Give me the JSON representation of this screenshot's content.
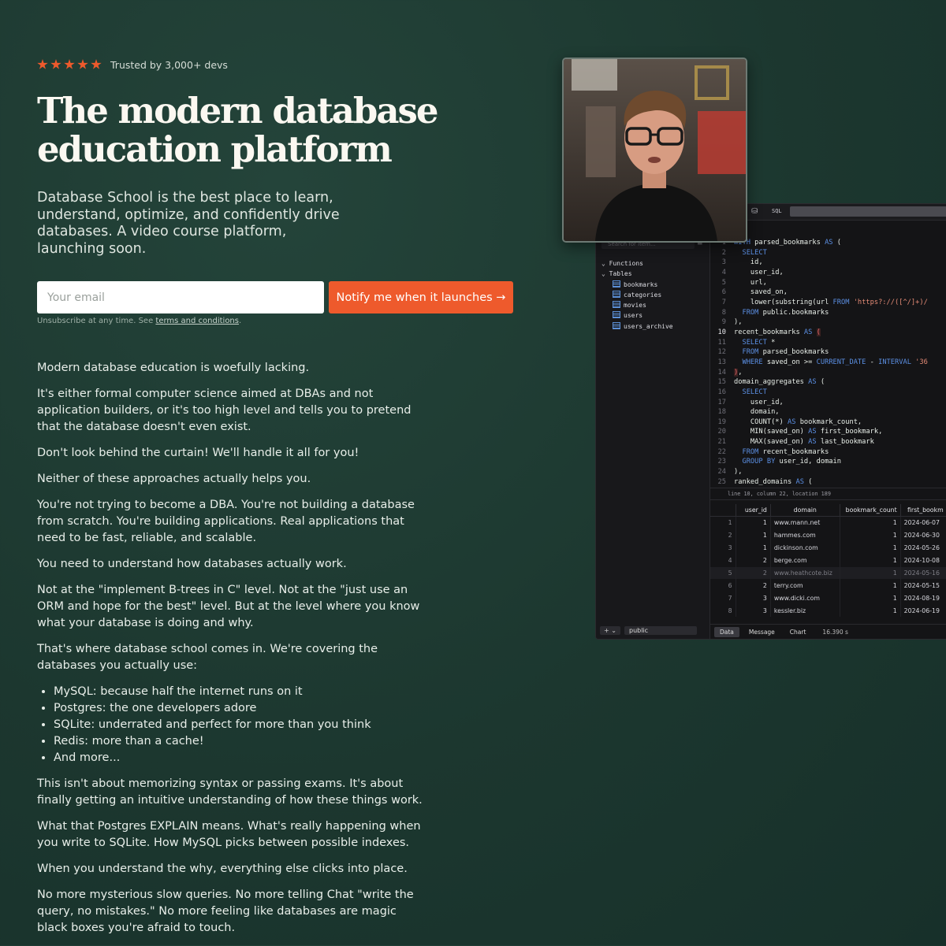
{
  "hero": {
    "trusted": "Trusted by 3,000+ devs",
    "title": "The modern database education platform",
    "subtitle": "Database School is the best place to learn, understand, optimize, and confidently drive databases. A video course platform, launching soon.",
    "email_placeholder": "Your email",
    "notify_label": "Notify me when it launches →",
    "fine_print": "Unsubscribe at any time. See ",
    "terms_link": "terms and conditions",
    "fine_print_end": "."
  },
  "body": {
    "p1": "Modern database education is woefully lacking.",
    "p2": "It's either formal computer science aimed at DBAs and not application builders, or it's too high level and tells you to pretend that the database doesn't even exist.",
    "p3": "Don't look behind the curtain! We'll handle it all for you!",
    "p4": "Neither of these approaches actually helps you.",
    "p5": "You're not trying to become a DBA. You're not building a database from scratch. You're building applications. Real applications that need to be fast, reliable, and scalable.",
    "p6": "You need to understand how databases actually work.",
    "p7": "Not at the \"implement B-trees in C\" level. Not at the \"just use an ORM and hope for the best\" level. But at the level where you know what your database is doing and why.",
    "p8": "That's where database school comes in. We're covering the databases you actually use:",
    "list": [
      "MySQL: because half the internet runs on it",
      "Postgres: the one developers adore",
      "SQLite: underrated and perfect for more than you think",
      "Redis: more than a cache!",
      "And more..."
    ],
    "p9": "This isn't about memorizing syntax or passing exams. It's about finally getting an intuitive understanding of how these things work.",
    "p10": "What that Postgres EXPLAIN means. What's really happening when you write to SQLite. How MySQL picks between possible indexes.",
    "p11": "When you understand the why, everything else clicks into place.",
    "p12": "No more mysterious slow queries. No more telling Chat \"write the query, no mistakes.\" No more feeling like databases are magic black boxes you're afraid to touch."
  },
  "app": {
    "sql_label": "SQL",
    "search_placeholder": "Search for item...",
    "tree": {
      "functions": "Functions",
      "tables": "Tables",
      "items": [
        "bookmarks",
        "categories",
        "movies",
        "users",
        "users_archive"
      ]
    },
    "status": "line 10, column 22, location 189",
    "columns": [
      "user_id",
      "domain",
      "bookmark_count",
      "first_bookm"
    ],
    "rows": [
      {
        "n": "1",
        "uid": "1",
        "dom": "www.mann.net",
        "cnt": "1",
        "fb": "2024-06-07"
      },
      {
        "n": "2",
        "uid": "1",
        "dom": "hammes.com",
        "cnt": "1",
        "fb": "2024-06-30"
      },
      {
        "n": "3",
        "uid": "1",
        "dom": "dickinson.com",
        "cnt": "1",
        "fb": "2024-05-26"
      },
      {
        "n": "4",
        "uid": "2",
        "dom": "berge.com",
        "cnt": "1",
        "fb": "2024-10-08"
      },
      {
        "n": "5",
        "uid": "2",
        "dom": "www.heathcote.biz",
        "cnt": "1",
        "fb": "2024-05-16"
      },
      {
        "n": "6",
        "uid": "2",
        "dom": "terry.com",
        "cnt": "1",
        "fb": "2024-05-15"
      },
      {
        "n": "7",
        "uid": "3",
        "dom": "www.dicki.com",
        "cnt": "1",
        "fb": "2024-08-19"
      },
      {
        "n": "8",
        "uid": "3",
        "dom": "kessler.biz",
        "cnt": "1",
        "fb": "2024-06-19"
      }
    ],
    "schema": "public",
    "plus": "+",
    "tabs": [
      "Data",
      "Message",
      "Chart"
    ],
    "timer": "16.390 s"
  },
  "colors": {
    "background": "#1d3a31",
    "accent": "#ee5a2c"
  }
}
